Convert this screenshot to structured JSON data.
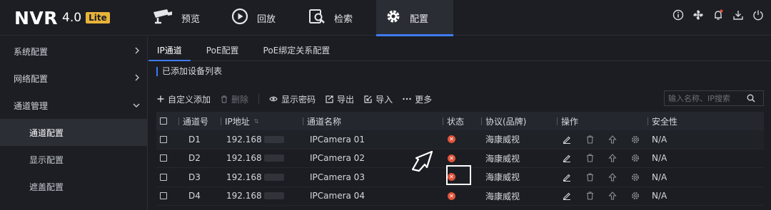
{
  "header": {
    "brand": "NVR",
    "version": "4.0",
    "edition": "Lite",
    "tabs": [
      {
        "label": "预览",
        "icon": "camera-icon"
      },
      {
        "label": "回放",
        "icon": "playback-icon"
      },
      {
        "label": "检索",
        "icon": "search-icon"
      },
      {
        "label": "配置",
        "icon": "gear-icon",
        "active": true
      }
    ],
    "tools": [
      "info-icon",
      "fan-icon",
      "bell-icon",
      "download-icon",
      "power-icon"
    ]
  },
  "sidebar": {
    "items": [
      {
        "label": "系统配置",
        "expanded": false
      },
      {
        "label": "网络配置",
        "expanded": false
      },
      {
        "label": "通道管理",
        "expanded": true
      }
    ],
    "subitems": [
      {
        "label": "通道配置",
        "active": true
      },
      {
        "label": "显示配置"
      },
      {
        "label": "遮盖配置"
      }
    ]
  },
  "main": {
    "subtabs": [
      "IP通道",
      "PoE配置",
      "PoE绑定关系配置"
    ],
    "section_title": "已添加设备列表",
    "toolbar": {
      "add": "自定义添加",
      "delete": "删除",
      "show_password": "显示密码",
      "export": "导出",
      "import": "导入",
      "more": "更多"
    },
    "search": {
      "placeholder": "输入名称、IP搜索"
    },
    "columns": {
      "channel": "通道号",
      "ip": "IP地址",
      "name": "通道名称",
      "status": "状态",
      "protocol": "协议(品牌)",
      "ops": "操作",
      "security": "安全性"
    },
    "rows": [
      {
        "channel": "D1",
        "ip": "192.168",
        "name": "IPCamera 01",
        "protocol": "海康威视",
        "security": "N/A"
      },
      {
        "channel": "D2",
        "ip": "192.168",
        "name": "IPCamera 02",
        "protocol": "海康威视",
        "security": "N/A"
      },
      {
        "channel": "D3",
        "ip": "192.168",
        "name": "IPCamera 03",
        "protocol": "海康威视",
        "security": "N/A"
      },
      {
        "channel": "D4",
        "ip": "192.168",
        "name": "IPCamera 04",
        "protocol": "海康威视",
        "security": "N/A"
      }
    ]
  },
  "colors": {
    "accent": "#3d7bf5",
    "status_error": "#e0533a",
    "badge": "#e8b33a"
  }
}
